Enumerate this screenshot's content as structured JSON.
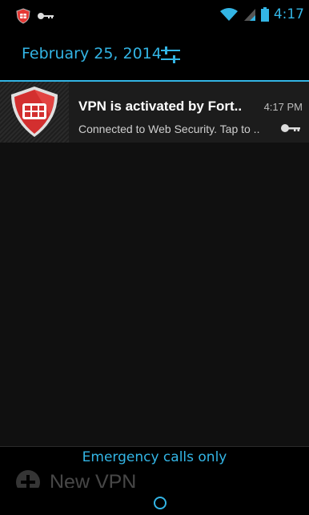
{
  "status_bar": {
    "time": "4:17",
    "icons": [
      "fortinet-shield-icon",
      "vpn-key-icon",
      "wifi-icon",
      "signal-icon",
      "battery-icon"
    ]
  },
  "shade": {
    "date": "February 25, 2014"
  },
  "notification": {
    "app_icon": "fortinet-shield-icon",
    "title": "VPN is activated by Fort..",
    "time": "4:17 PM",
    "text": "Connected to Web Security. Tap to ..",
    "indicator_icon": "vpn-key-icon"
  },
  "lockscreen": {
    "emergency_text": "Emergency calls only",
    "behind_label": "New VPN"
  },
  "colors": {
    "accent": "#33b5e5",
    "shield_red": "#d32f2f"
  }
}
